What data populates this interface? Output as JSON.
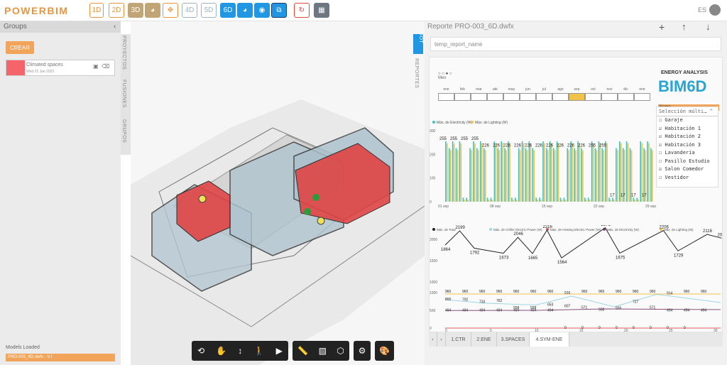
{
  "app": {
    "logo": "POWERBIM",
    "lang": "ES"
  },
  "toolbar": {
    "b1d": "1D",
    "b2d": "2D",
    "b3d": "3D",
    "b4d": "4D",
    "b5d": "5D",
    "b6d": "6D"
  },
  "left": {
    "header": "Groups",
    "crear": "CREAR",
    "group_name": "Climated spaces",
    "group_date": "Wed 22 Jan 2020",
    "models_label": "Models Loaded",
    "model_file": "PRO-003_6D.dwfx - V.I"
  },
  "vtabs": [
    "PROYECTOS",
    "FUSIONES",
    "GRUPOS"
  ],
  "right": {
    "header": "Reporte PRO-003_6D.dwfx",
    "tabs": [
      "IOT",
      "REPORTES"
    ],
    "report_name_placeholder": "temp_report_name"
  },
  "report": {
    "energy_title": "ENERGY ANALYSIS",
    "brand": "BIM6D",
    "name_label": "Name",
    "selection": "Selección múlti…",
    "months": [
      "ene",
      "feb",
      "mar",
      "abr",
      "may",
      "jun",
      "jul",
      "ago",
      "sep",
      "oct",
      "nov",
      "dic",
      "ene"
    ],
    "selected_month": "sep",
    "filter_items": [
      {
        "label": "Garaje",
        "checked": false
      },
      {
        "label": "Habitación 1",
        "checked": true
      },
      {
        "label": "Habitación 2",
        "checked": true
      },
      {
        "label": "Habitación 3",
        "checked": true
      },
      {
        "label": "Lavandería",
        "checked": false
      },
      {
        "label": "Pasillo Estudio",
        "checked": false
      },
      {
        "label": "Salon Comedor",
        "checked": true
      },
      {
        "label": "Vestidor",
        "checked": false
      }
    ],
    "footer_tabs": [
      "1.CTR",
      "2.ENE",
      "3.SPACES",
      "4.SYM-ENE"
    ],
    "active_footer": "4.SYM-ENE"
  },
  "chart_data": [
    {
      "type": "bar",
      "series": [
        {
          "name": "Máx. de Electricity (W)",
          "color": "#3cc2c2"
        },
        {
          "name": "Máx. de Lighting (W)",
          "color": "#f1c24a"
        }
      ],
      "ylim": [
        0,
        300
      ],
      "yticks": [
        0,
        100,
        200,
        300
      ],
      "xticks": [
        "01 sep",
        "08 sep",
        "15 sep",
        "22 sep",
        "29 sep"
      ],
      "labels": [
        "255",
        "255",
        "255",
        "255",
        "226",
        "226",
        "226",
        "226",
        "226",
        "226",
        "226",
        "226",
        "226",
        "226",
        "255",
        "255",
        "17",
        "17",
        "17",
        "17"
      ]
    },
    {
      "type": "line",
      "legend": [
        "Máx. de Total",
        "Máx. de Chiller Electric Power (W)",
        "Máx. de Heating Electric Power (W)",
        "Máx. de Electricity (W)",
        "Máx. de Lighting (W)"
      ],
      "ylim": [
        1000,
        2000
      ],
      "yticks": [
        1000,
        1500,
        2000
      ],
      "values": [
        {
          "x": 0,
          "y": 1864
        },
        {
          "x": 1,
          "y": 2199
        },
        {
          "x": 2,
          "y": 1792
        },
        {
          "x": 4,
          "y": 1673
        },
        {
          "x": 5,
          "y": 2046
        },
        {
          "x": 6,
          "y": 1665
        },
        {
          "x": 7,
          "y": 2216
        },
        {
          "x": 8,
          "y": 1564
        },
        {
          "x": 11,
          "y": 2271
        },
        {
          "x": 12,
          "y": 1675
        },
        {
          "x": 15,
          "y": 2206
        },
        {
          "x": 16,
          "y": 1729
        },
        {
          "x": 18,
          "y": 2116
        },
        {
          "x": 19,
          "y": 2026
        }
      ]
    },
    {
      "type": "line",
      "ylim": [
        0,
        1000
      ],
      "yticks": [
        0,
        500,
        1000
      ],
      "xticks": [
        "0",
        "5",
        "10",
        "15",
        "20",
        "25",
        "30"
      ],
      "labels": [
        "960",
        "960",
        "960",
        "960",
        "960",
        "960",
        "960",
        "916",
        "960",
        "965",
        "960",
        "960",
        "960",
        "914",
        "960",
        "960",
        "800",
        "792",
        "733",
        "762",
        "558",
        "558",
        "653",
        "607",
        "571",
        "508",
        "555",
        "727",
        "571",
        "494",
        "494",
        "494",
        "494",
        "494",
        "494",
        "494",
        "494",
        "494",
        "494",
        "0",
        "0",
        "0",
        "0",
        "0",
        "0",
        "0",
        "0"
      ]
    }
  ]
}
